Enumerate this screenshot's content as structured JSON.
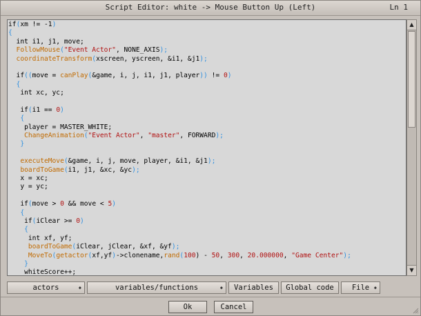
{
  "window": {
    "title": "Script Editor: white -> Mouse Button Up (Left)",
    "line_indicator": "Ln 1"
  },
  "code_lines": [
    [
      {
        "t": "if",
        "c": "kw"
      },
      {
        "t": "(",
        "c": "punc"
      },
      {
        "t": "xm != -1",
        "c": "default"
      },
      {
        "t": ")",
        "c": "punc"
      }
    ],
    [
      {
        "t": "{",
        "c": "punc"
      }
    ],
    [
      {
        "t": "  int i1, j1, move;",
        "c": "default"
      }
    ],
    [
      {
        "t": "  FollowMouse",
        "c": "func"
      },
      {
        "t": "(",
        "c": "punc"
      },
      {
        "t": "\"Event Actor\"",
        "c": "str"
      },
      {
        "t": ", NONE_AXIS",
        "c": "default"
      },
      {
        "t": ");",
        "c": "punc"
      }
    ],
    [
      {
        "t": "  coordinateTransform",
        "c": "func"
      },
      {
        "t": "(",
        "c": "punc"
      },
      {
        "t": "xscreen, yscreen, &i1, &j1",
        "c": "default"
      },
      {
        "t": ");",
        "c": "punc"
      }
    ],
    [],
    [
      {
        "t": "  if",
        "c": "kw"
      },
      {
        "t": "((",
        "c": "punc"
      },
      {
        "t": "move = ",
        "c": "default"
      },
      {
        "t": "canPlay",
        "c": "func"
      },
      {
        "t": "(",
        "c": "punc"
      },
      {
        "t": "&game, i, j, i1, j1, player",
        "c": "default"
      },
      {
        "t": "))",
        "c": "punc"
      },
      {
        "t": " != ",
        "c": "default"
      },
      {
        "t": "0",
        "c": "num"
      },
      {
        "t": ")",
        "c": "punc"
      }
    ],
    [
      {
        "t": "  {",
        "c": "punc"
      }
    ],
    [
      {
        "t": "   int xc, yc;",
        "c": "default"
      }
    ],
    [],
    [
      {
        "t": "   if",
        "c": "kw"
      },
      {
        "t": "(",
        "c": "punc"
      },
      {
        "t": "i1 == ",
        "c": "default"
      },
      {
        "t": "0",
        "c": "num"
      },
      {
        "t": ")",
        "c": "punc"
      }
    ],
    [
      {
        "t": "   {",
        "c": "punc"
      }
    ],
    [
      {
        "t": "    player = MASTER_WHITE;",
        "c": "default"
      }
    ],
    [
      {
        "t": "    ChangeAnimation",
        "c": "func"
      },
      {
        "t": "(",
        "c": "punc"
      },
      {
        "t": "\"Event Actor\"",
        "c": "str"
      },
      {
        "t": ", ",
        "c": "default"
      },
      {
        "t": "\"master\"",
        "c": "str"
      },
      {
        "t": ", FORWARD",
        "c": "default"
      },
      {
        "t": ");",
        "c": "punc"
      }
    ],
    [
      {
        "t": "   }",
        "c": "punc"
      }
    ],
    [],
    [
      {
        "t": "   executeMove",
        "c": "func"
      },
      {
        "t": "(",
        "c": "punc"
      },
      {
        "t": "&game, i, j, move, player, &i1, &j1",
        "c": "default"
      },
      {
        "t": ");",
        "c": "punc"
      }
    ],
    [
      {
        "t": "   boardToGame",
        "c": "func"
      },
      {
        "t": "(",
        "c": "punc"
      },
      {
        "t": "i1, j1, &xc, &yc",
        "c": "default"
      },
      {
        "t": ");",
        "c": "punc"
      }
    ],
    [
      {
        "t": "   x = xc;",
        "c": "default"
      }
    ],
    [
      {
        "t": "   y = yc;",
        "c": "default"
      }
    ],
    [],
    [
      {
        "t": "   if",
        "c": "kw"
      },
      {
        "t": "(",
        "c": "punc"
      },
      {
        "t": "move > ",
        "c": "default"
      },
      {
        "t": "0",
        "c": "num"
      },
      {
        "t": " && move < ",
        "c": "default"
      },
      {
        "t": "5",
        "c": "num"
      },
      {
        "t": ")",
        "c": "punc"
      }
    ],
    [
      {
        "t": "   {",
        "c": "punc"
      }
    ],
    [
      {
        "t": "    if",
        "c": "kw"
      },
      {
        "t": "(",
        "c": "punc"
      },
      {
        "t": "iClear >= ",
        "c": "default"
      },
      {
        "t": "0",
        "c": "num"
      },
      {
        "t": ")",
        "c": "punc"
      }
    ],
    [
      {
        "t": "    {",
        "c": "punc"
      }
    ],
    [
      {
        "t": "     int xf, yf;",
        "c": "default"
      }
    ],
    [
      {
        "t": "     boardToGame",
        "c": "func"
      },
      {
        "t": "(",
        "c": "punc"
      },
      {
        "t": "iClear, jClear, &xf, &yf",
        "c": "default"
      },
      {
        "t": ");",
        "c": "punc"
      }
    ],
    [
      {
        "t": "     MoveTo",
        "c": "func"
      },
      {
        "t": "(",
        "c": "punc"
      },
      {
        "t": "getactor",
        "c": "func"
      },
      {
        "t": "(",
        "c": "punc"
      },
      {
        "t": "xf,yf",
        "c": "default"
      },
      {
        "t": ")",
        "c": "punc"
      },
      {
        "t": "->clonename,",
        "c": "default"
      },
      {
        "t": "rand",
        "c": "func"
      },
      {
        "t": "(",
        "c": "punc"
      },
      {
        "t": "100",
        "c": "num"
      },
      {
        "t": ") - ",
        "c": "default"
      },
      {
        "t": "50",
        "c": "num"
      },
      {
        "t": ", ",
        "c": "default"
      },
      {
        "t": "300",
        "c": "num"
      },
      {
        "t": ", ",
        "c": "default"
      },
      {
        "t": "20.000000",
        "c": "num"
      },
      {
        "t": ", ",
        "c": "default"
      },
      {
        "t": "\"Game Center\"",
        "c": "str"
      },
      {
        "t": ");",
        "c": "punc"
      }
    ],
    [
      {
        "t": "    }",
        "c": "punc"
      }
    ],
    [
      {
        "t": "    whiteScore++;",
        "c": "default"
      }
    ]
  ],
  "toolbar": {
    "actors_label": "actors",
    "variables_functions_label": "variables/functions",
    "variables_label": "Variables",
    "global_code_label": "Global code",
    "file_label": "File"
  },
  "dialog": {
    "ok_label": "Ok",
    "cancel_label": "Cancel"
  },
  "icons": {
    "scroll_up": "up-arrow-icon",
    "scroll_down": "down-arrow-icon",
    "dropdown": "dropdown-arrow-icon"
  }
}
